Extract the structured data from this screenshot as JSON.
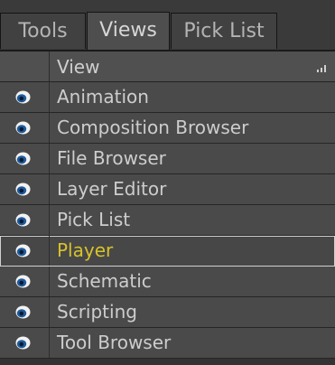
{
  "tabs": [
    {
      "label": "Tools"
    },
    {
      "label": "Views"
    },
    {
      "label": "Pick List"
    }
  ],
  "active_tab": "Views",
  "list": {
    "header": "View",
    "items": [
      {
        "label": "Animation"
      },
      {
        "label": "Composition Browser"
      },
      {
        "label": "File Browser"
      },
      {
        "label": "Layer Editor"
      },
      {
        "label": "Pick List"
      },
      {
        "label": "Player"
      },
      {
        "label": "Schematic"
      },
      {
        "label": "Scripting"
      },
      {
        "label": "Tool Browser"
      }
    ],
    "selected_item": "Player",
    "row_icon": "eye-icon"
  },
  "colors": {
    "background": "#333333",
    "row": "#4a4a4a",
    "text": "#cdcdcd",
    "selected_text": "#d8c22a",
    "eye_blue": "#1e5a9a"
  }
}
